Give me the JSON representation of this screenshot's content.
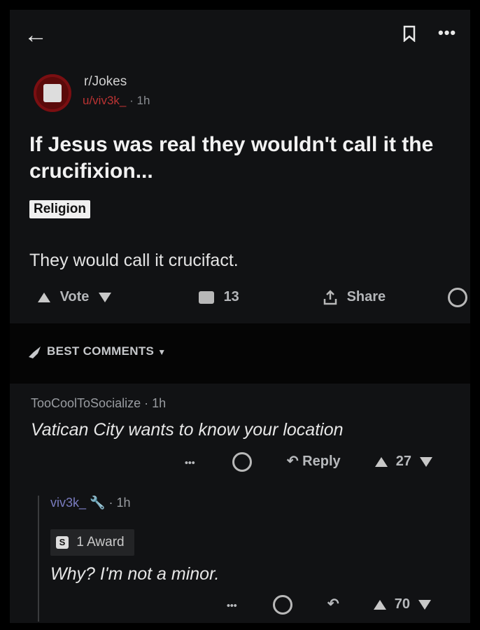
{
  "topbar": {
    "back_icon": "←",
    "more_icon": "•••"
  },
  "post": {
    "subreddit": "r/Jokes",
    "author": "u/viv3k_",
    "age": "· 1h",
    "title": "If Jesus was real they wouldn't call it the crucifixion...",
    "flair": "Religion",
    "body": "They would call it crucifact.",
    "vote_label": "Vote",
    "comment_count": "13",
    "share_label": "Share"
  },
  "sort": {
    "label": "BEST COMMENTS"
  },
  "comments": [
    {
      "author": "TooCoolToSocialize",
      "age": "· 1h",
      "text": "Vatican City wants to know your location",
      "reply_label": "Reply",
      "score": "27"
    },
    {
      "author": "viv3k_",
      "age": "· 1h",
      "award": "1 Award",
      "award_icon_text": "S",
      "text": "Why? I'm not a minor.",
      "score": "70"
    }
  ],
  "colors": {
    "background": "#111214",
    "outer": "#000000",
    "author_red": "#b33333"
  }
}
